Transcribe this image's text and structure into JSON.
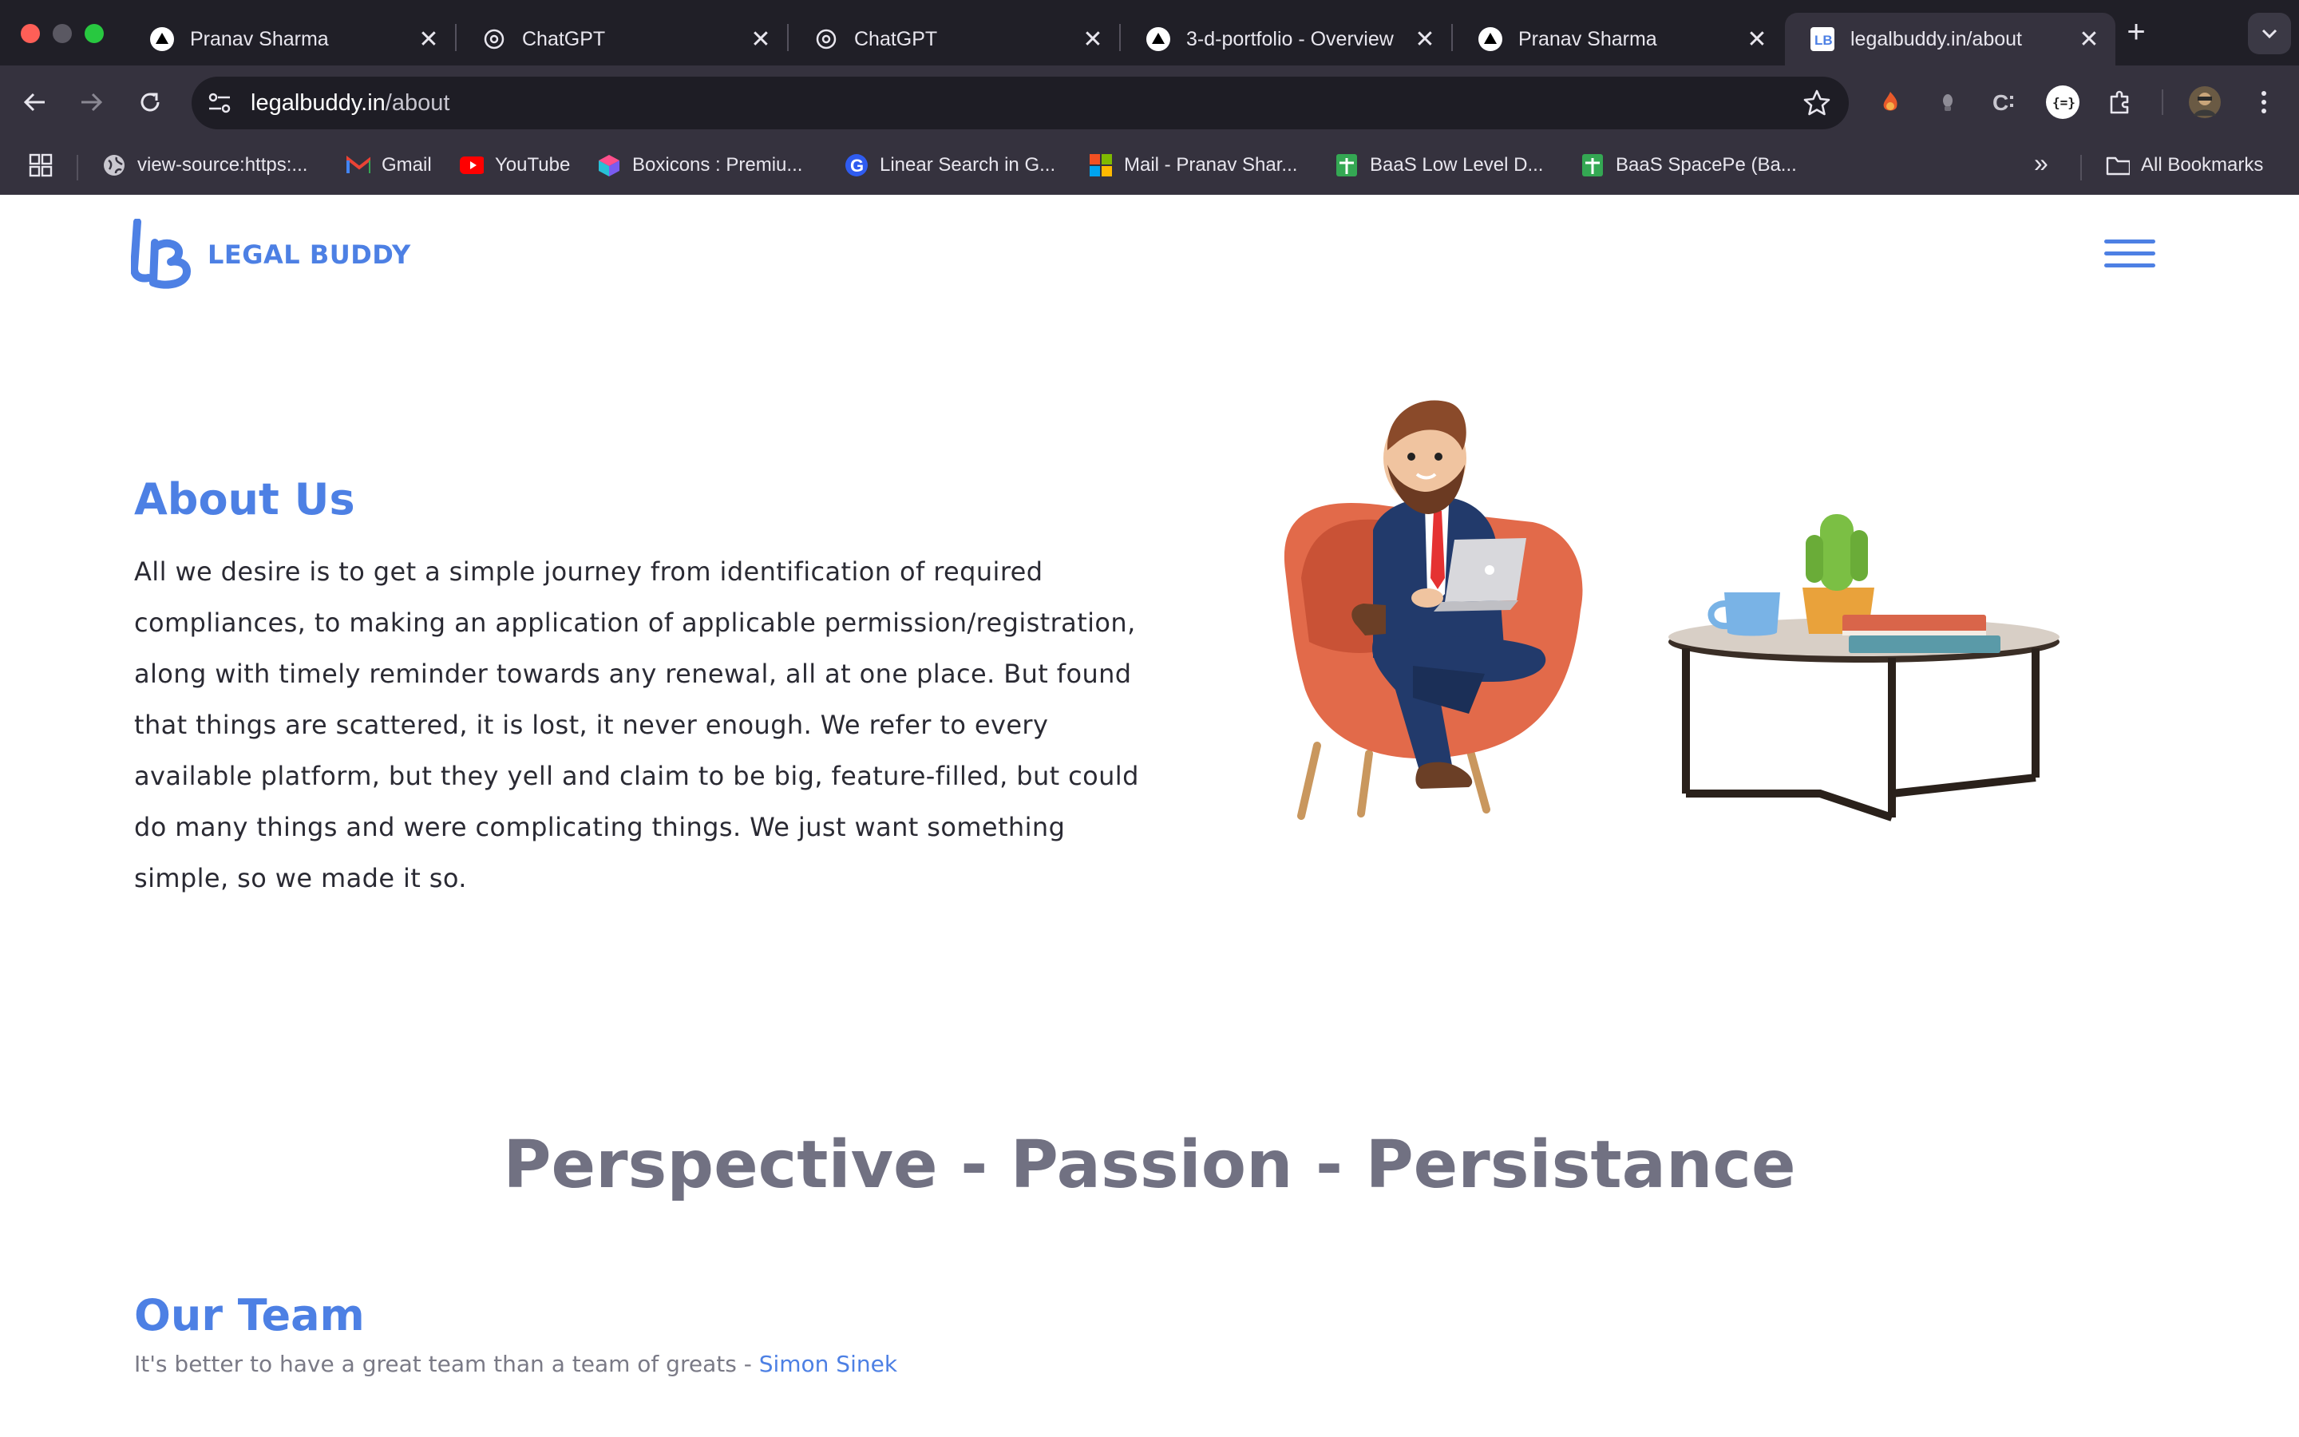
{
  "browser": {
    "tabs": [
      {
        "title": "Pranav Sharma",
        "icon": "vercel-triangle-icon",
        "active": false
      },
      {
        "title": "ChatGPT",
        "icon": "openai-icon",
        "active": false
      },
      {
        "title": "ChatGPT",
        "icon": "openai-icon",
        "active": false
      },
      {
        "title": "3-d-portfolio - Overview",
        "icon": "vercel-triangle-icon",
        "active": false
      },
      {
        "title": "Pranav Sharma",
        "icon": "vercel-triangle-icon",
        "active": false
      },
      {
        "title": "legalbuddy.in/about",
        "icon": "legalbuddy-icon",
        "active": true
      }
    ],
    "close_glyph": "✕",
    "new_tab_glyph": "+",
    "url": {
      "host": "legalbuddy.in",
      "path": "/about"
    },
    "bookmarks": [
      {
        "label": "view-source:https:...",
        "icon": "globe-icon"
      },
      {
        "label": "Gmail",
        "icon": "gmail-icon"
      },
      {
        "label": "YouTube",
        "icon": "youtube-icon"
      },
      {
        "label": "Boxicons : Premiu...",
        "icon": "boxicons-icon"
      },
      {
        "label": "Linear Search in G...",
        "icon": "g-icon"
      },
      {
        "label": "Mail - Pranav Shar...",
        "icon": "microsoft-icon"
      },
      {
        "label": "BaaS Low Level D...",
        "icon": "sheets-icon"
      },
      {
        "label": "BaaS SpacePe (Ba...",
        "icon": "sheets-icon"
      }
    ],
    "more_bookmarks_glyph": "»",
    "all_bookmarks_label": "All Bookmarks"
  },
  "site": {
    "logo_text": "LEGAL BUDDY",
    "about": {
      "title": "About Us",
      "body": "All we desire is to get a simple journey from identification of required compliances, to making an application of applicable permission/registration, along with timely reminder towards any renewal, all at one place. But found that things are scattered, it is lost, it never enough. We refer to every available platform, but they yell and claim to be big, feature-filled, but could do many things and were complicating things. We just want something simple, so we made it so."
    },
    "tagline": "Perspective - Passion - Persistance",
    "team": {
      "title": "Our Team",
      "quote": "It's better to have a great team than a team of greats - ",
      "quote_author": "Simon Sinek"
    }
  },
  "colors": {
    "accent": "#4d80e4",
    "chrome_bg": "#35323e",
    "tabstrip_bg": "#201f27",
    "tagline": "#717182"
  }
}
